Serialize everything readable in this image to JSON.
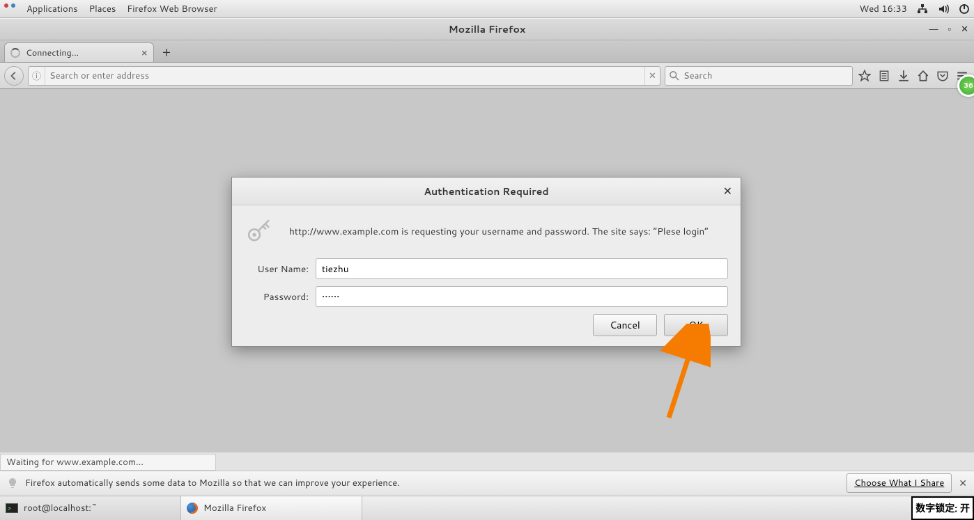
{
  "gnome": {
    "applications": "Applications",
    "places": "Places",
    "app_title": "Firefox Web Browser",
    "clock": "Wed 16:33"
  },
  "window": {
    "title": "Mozilla Firefox"
  },
  "tab": {
    "title": "Connecting..."
  },
  "urlbar": {
    "placeholder": "Search or enter address",
    "value": ""
  },
  "searchbar": {
    "placeholder": "Search",
    "value": ""
  },
  "badge360": "36",
  "status": {
    "text": "Waiting for www.example.com..."
  },
  "infobar": {
    "text": "Firefox automatically sends some data to Mozilla so that we can improve your experience.",
    "button": "Choose What I Share"
  },
  "taskbar": {
    "items": [
      {
        "label": "root@localhost:~"
      },
      {
        "label": "Mozilla Firefox"
      }
    ]
  },
  "indicator": {
    "text": "数字锁定: 开"
  },
  "dialog": {
    "title": "Authentication Required",
    "message": "http://www.example.com is requesting your username and password. The site says: “Plese login”",
    "username_label": "User Name:",
    "password_label": "Password:",
    "username_value": "tiezhu",
    "password_value": "••••••",
    "cancel": "Cancel",
    "ok": "OK"
  }
}
